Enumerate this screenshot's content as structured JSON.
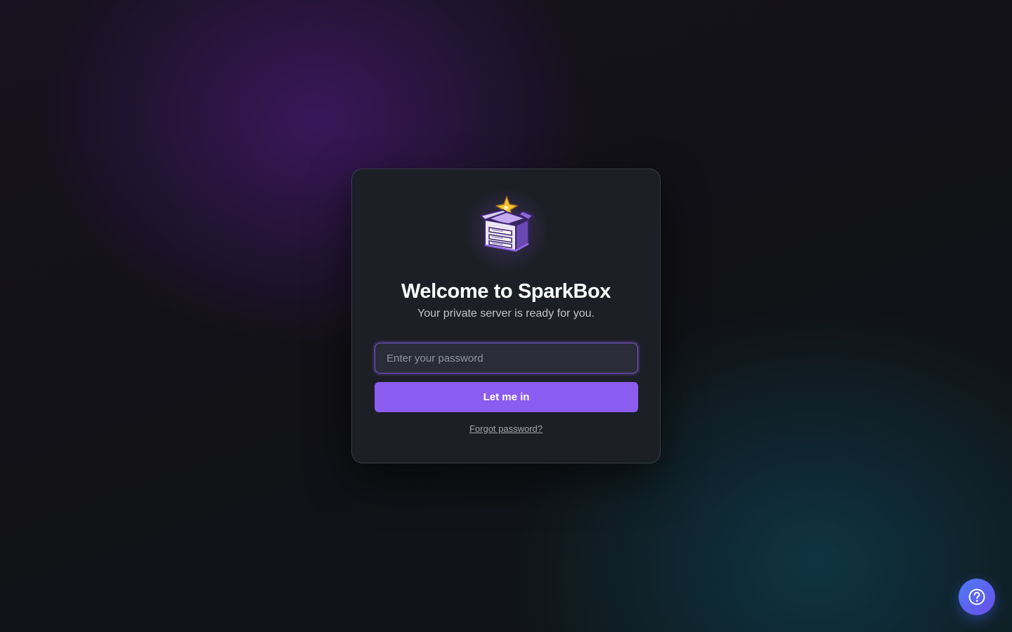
{
  "login": {
    "title": "Welcome to SparkBox",
    "subtitle": "Your private server is ready for you.",
    "password_placeholder": "Enter your password",
    "password_value": "",
    "submit_label": "Let me in",
    "forgot_label": "Forgot password?"
  },
  "logo": {
    "icon": "sparkbox-server-box-icon"
  },
  "help": {
    "icon": "question-circle-icon"
  },
  "colors": {
    "accent": "#8b5cf0",
    "card_background": "#1d1f26",
    "input_border": "#7e55d6",
    "help_button": "#4d7cf6"
  }
}
